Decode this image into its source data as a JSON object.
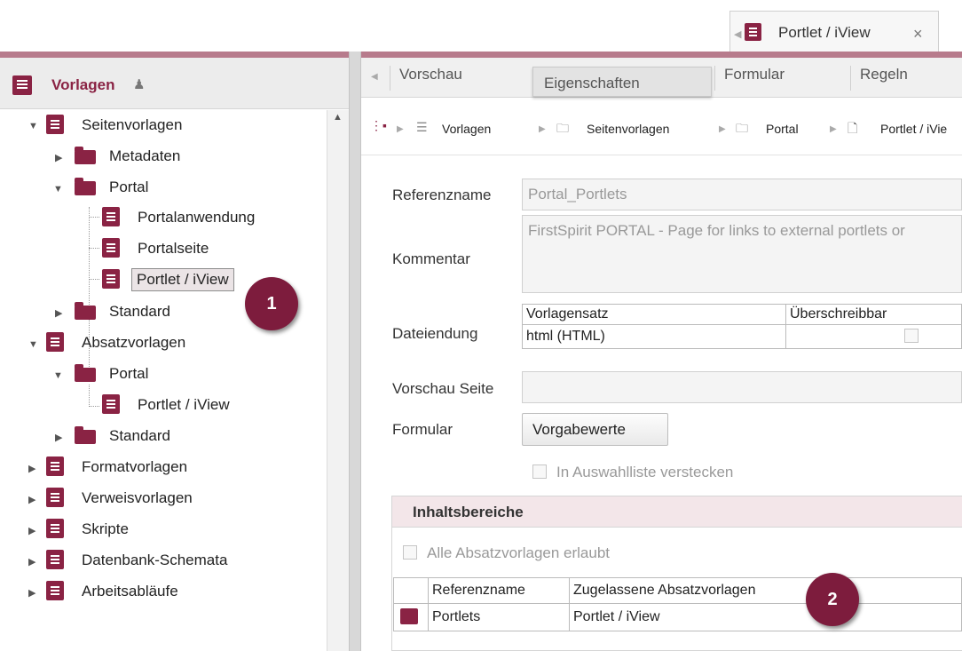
{
  "doc_tab": {
    "label": "Portlet / iView",
    "close": "×",
    "icon": "page-template-icon"
  },
  "left_panel": {
    "title": "Vorlagen",
    "tree": {
      "seitenvorlagen": "Seitenvorlagen",
      "metadaten": "Metadaten",
      "portal": "Portal",
      "portalanwendung": "Portalanwendung",
      "portalseite": "Portalseite",
      "portlet_iview": "Portlet / iView",
      "standard": "Standard",
      "absatzvorlagen": "Absatzvorlagen",
      "abs_portal": "Portal",
      "abs_portlet_iview": "Portlet / iView",
      "abs_standard": "Standard",
      "formatvorlagen": "Formatvorlagen",
      "verweisvorlagen": "Verweisvorlagen",
      "skripte": "Skripte",
      "datenbank_schemata": "Datenbank-Schemata",
      "arbeitsablaeufe": "Arbeitsabläufe"
    }
  },
  "callouts": {
    "one": "1",
    "two": "2"
  },
  "tabs": {
    "vorschau": "Vorschau",
    "eigenschaften": "Eigenschaften",
    "formular": "Formular",
    "regeln": "Regeln"
  },
  "breadcrumb": {
    "vorlagen": "Vorlagen",
    "seitenvorlagen": "Seitenvorlagen",
    "portal": "Portal",
    "current": "Portlet / iVie"
  },
  "form": {
    "referenzname_label": "Referenzname",
    "referenzname_value": "Portal_Portlets",
    "kommentar_label": "Kommentar",
    "kommentar_value": "FirstSpirit PORTAL - Page for links to external portlets or",
    "dateiendung_label": "Dateiendung",
    "ext_table": {
      "headers": [
        "Vorlagensatz",
        "Überschreibbar"
      ],
      "rows": [
        [
          "html (HTML)",
          ""
        ]
      ]
    },
    "vorschau_seite_label": "Vorschau Seite",
    "vorschau_seite_value": "",
    "formular_label": "Formular",
    "vorgabewerte_button": "Vorgabewerte",
    "hide_checkbox_label": "In Auswahlliste verstecken"
  },
  "inhaltsbereiche": {
    "title": "Inhaltsbereiche",
    "alle_label": "Alle Absatzvorlagen erlaubt",
    "headers": [
      "Referenzname",
      "Zugelassene Absatzvorlagen"
    ],
    "rows": [
      [
        "Portlets",
        "Portlet / iView"
      ]
    ]
  }
}
